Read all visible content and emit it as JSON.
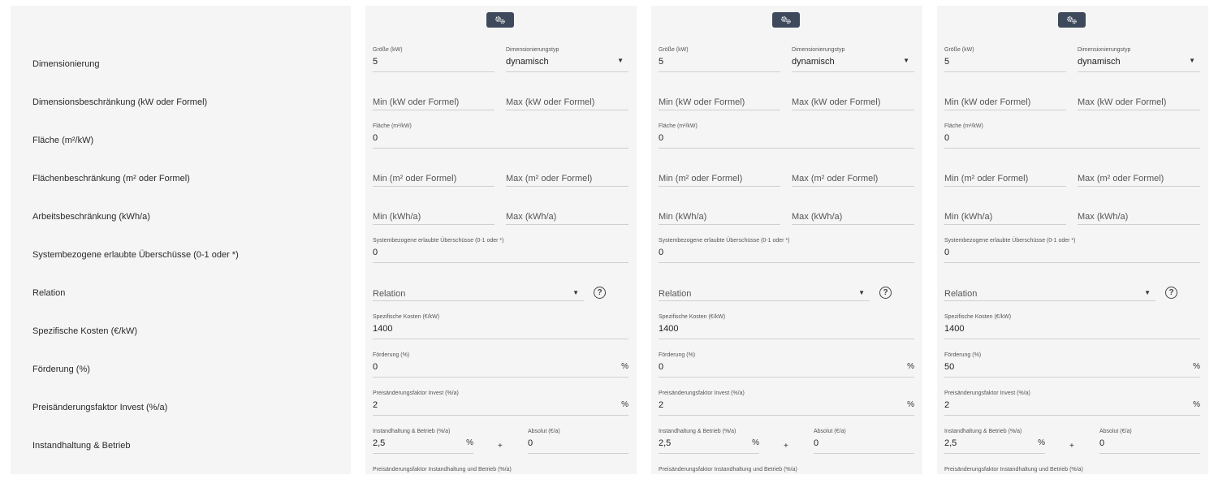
{
  "row_labels": [
    "Dimensionierung",
    "Dimensionsbeschränkung (kW oder Formel)",
    "Fläche (m²/kW)",
    "Flächenbeschränkung (m² oder Formel)",
    "Arbeitsbeschränkung (kWh/a)",
    "Systembezogene erlaubte Überschüsse (0-1 oder *)",
    "Relation",
    "Spezifische Kosten (€/kW)",
    "Förderung (%)",
    "Preisänderungsfaktor Invest (%/a)",
    "Instandhaltung & Betrieb"
  ],
  "icons": {
    "settings": "gears-icon",
    "help": "help-circle-icon",
    "dropdown": "caret-down-icon"
  },
  "colors": {
    "button_bg": "#3e4a5c",
    "panel_bg": "#f5f5f5"
  },
  "columns": [
    {
      "size_label": "Größe (kW)",
      "size_value": "5",
      "dimtype_label": "Dimensionierungstyp",
      "dimtype_value": "dynamisch",
      "dim_min_placeholder": "Min (kW oder Formel)",
      "dim_max_placeholder": "Max (kW oder Formel)",
      "area_label": "Fläche (m²/kW)",
      "area_value": "0",
      "area_min_placeholder": "Min (m² oder Formel)",
      "area_max_placeholder": "Max (m² oder Formel)",
      "work_min_placeholder": "Min (kWh/a)",
      "work_max_placeholder": "Max (kWh/a)",
      "surplus_label": "Systembezogene erlaubte Überschüsse (0-1 oder *)",
      "surplus_value": "0",
      "relation_placeholder": "Relation",
      "cost_label": "Spezifische Kosten (€/kW)",
      "cost_value": "1400",
      "funding_label": "Förderung (%)",
      "funding_value": "0",
      "funding_unit": "%",
      "invest_factor_label": "Preisänderungsfaktor Invest (%/a)",
      "invest_factor_value": "2",
      "invest_factor_unit": "%",
      "maint_label": "Instandhaltung & Betrieb (%/a)",
      "maint_value": "2,5",
      "maint_unit": "%",
      "plus": "+",
      "absolute_label": "Absolut (€/a)",
      "absolute_value": "0",
      "maint_factor_label": "Preisänderungsfaktor Instandhaltung und Betrieb (%/a)"
    },
    {
      "size_label": "Größe (kW)",
      "size_value": "5",
      "dimtype_label": "Dimensionierungstyp",
      "dimtype_value": "dynamisch",
      "dim_min_placeholder": "Min (kW oder Formel)",
      "dim_max_placeholder": "Max (kW oder Formel)",
      "area_label": "Fläche (m²/kW)",
      "area_value": "0",
      "area_min_placeholder": "Min (m² oder Formel)",
      "area_max_placeholder": "Max (m² oder Formel)",
      "work_min_placeholder": "Min (kWh/a)",
      "work_max_placeholder": "Max (kWh/a)",
      "surplus_label": "Systembezogene erlaubte Überschüsse (0-1 oder *)",
      "surplus_value": "0",
      "relation_placeholder": "Relation",
      "cost_label": "Spezifische Kosten (€/kW)",
      "cost_value": "1400",
      "funding_label": "Förderung (%)",
      "funding_value": "0",
      "funding_unit": "%",
      "invest_factor_label": "Preisänderungsfaktor Invest (%/a)",
      "invest_factor_value": "2",
      "invest_factor_unit": "%",
      "maint_label": "Instandhaltung & Betrieb (%/a)",
      "maint_value": "2,5",
      "maint_unit": "%",
      "plus": "+",
      "absolute_label": "Absolut (€/a)",
      "absolute_value": "0",
      "maint_factor_label": "Preisänderungsfaktor Instandhaltung und Betrieb (%/a)"
    },
    {
      "size_label": "Größe (kW)",
      "size_value": "5",
      "dimtype_label": "Dimensionierungstyp",
      "dimtype_value": "dynamisch",
      "dim_min_placeholder": "Min (kW oder Formel)",
      "dim_max_placeholder": "Max (kW oder Formel)",
      "area_label": "Fläche (m²/kW)",
      "area_value": "0",
      "area_min_placeholder": "Min (m² oder Formel)",
      "area_max_placeholder": "Max (m² oder Formel)",
      "work_min_placeholder": "Min (kWh/a)",
      "work_max_placeholder": "Max (kWh/a)",
      "surplus_label": "Systembezogene erlaubte Überschüsse (0-1 oder *)",
      "surplus_value": "0",
      "relation_placeholder": "Relation",
      "cost_label": "Spezifische Kosten (€/kW)",
      "cost_value": "1400",
      "funding_label": "Förderung (%)",
      "funding_value": "50",
      "funding_unit": "%",
      "invest_factor_label": "Preisänderungsfaktor Invest (%/a)",
      "invest_factor_value": "2",
      "invest_factor_unit": "%",
      "maint_label": "Instandhaltung & Betrieb (%/a)",
      "maint_value": "2,5",
      "maint_unit": "%",
      "plus": "+",
      "absolute_label": "Absolut (€/a)",
      "absolute_value": "0",
      "maint_factor_label": "Preisänderungsfaktor Instandhaltung und Betrieb (%/a)"
    }
  ]
}
